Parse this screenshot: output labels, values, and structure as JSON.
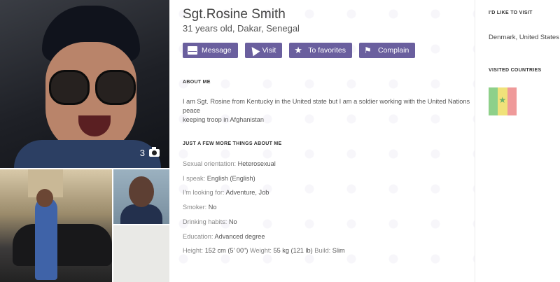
{
  "profile": {
    "name": "Sgt.Rosine Smith",
    "location": "31 years old, Dakar, Senegal",
    "photo_count": "3"
  },
  "actions": {
    "message": "Message",
    "visit": "Visit",
    "favorites": "To favorites",
    "complain": "Complain"
  },
  "about": {
    "title": "ABOUT ME",
    "text_line1": "I am Sgt. Rosine from Kentucky in the United state but I am a soldier working with the United Nations",
    "text_line2": "peace",
    "text_line3": "keeping troop in Afghanistan"
  },
  "more": {
    "title": "JUST A FEW MORE THINGS ABOUT ME",
    "orientation_label": "Sexual orientation:",
    "orientation": "Heterosexual",
    "speak_label": "I speak:",
    "speak": "English (English)",
    "looking_label": "I'm looking for:",
    "looking": "Adventure, Job",
    "smoker_label": "Smoker:",
    "smoker": "No",
    "drinking_label": "Drinking habits:",
    "drinking": "No",
    "education_label": "Education:",
    "education": "Advanced degree",
    "height_label": "Height:",
    "height": "152 cm (5' 00\")",
    "weight_label": "Weight:",
    "weight": "55 kg (121 lb)",
    "build_label": "Build:",
    "build": "Slim"
  },
  "sidebar": {
    "visit_title": "I'D LIKE TO VISIT",
    "visit_countries": "Denmark, United States",
    "visited_title": "VISITED COUNTRIES"
  }
}
